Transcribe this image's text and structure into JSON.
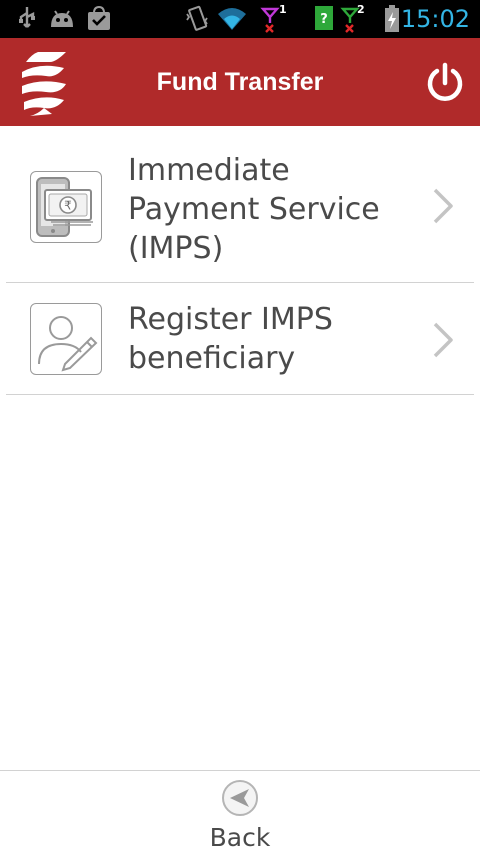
{
  "status_bar": {
    "time": "15:02",
    "sim1_label": "1",
    "sim2_label": "2",
    "icons": [
      "usb-icon",
      "android-debug-icon",
      "shopping-bag-check-icon",
      "vibrate-icon",
      "wifi-icon",
      "signal-sim1-icon",
      "unknown-sim-icon",
      "signal-sim2-icon",
      "battery-charging-icon"
    ]
  },
  "header": {
    "title": "Fund Transfer",
    "background_color": "#b02a2a",
    "logo_icon": "bank-logo-icon",
    "power_icon": "power-icon"
  },
  "menu": {
    "items": [
      {
        "label": "Immediate Payment Service (IMPS)",
        "icon": "mobile-payment-icon"
      },
      {
        "label": "Register IMPS beneficiary",
        "icon": "register-user-icon"
      }
    ]
  },
  "footer": {
    "back_label": "Back",
    "back_icon": "back-arrow-icon"
  }
}
